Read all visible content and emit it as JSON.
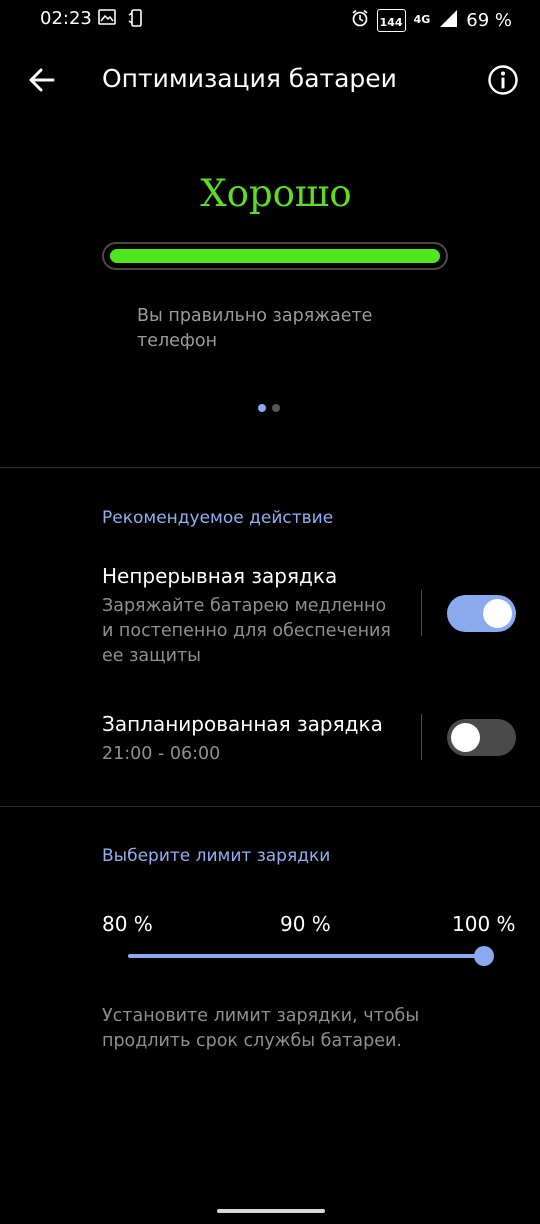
{
  "status_bar": {
    "time": "02:23",
    "refresh_rate": "144",
    "network": "4G",
    "battery": "69 %"
  },
  "app_bar": {
    "title": "Оптимизация батареи"
  },
  "health": {
    "status": "Хорошо",
    "level_fraction": 1.0,
    "color": "#5edb2a",
    "description": "Вы правильно заряжаете телефон"
  },
  "pager": {
    "pages": 2,
    "current": 1
  },
  "recommended": {
    "header": "Рекомендуемое действие",
    "items": [
      {
        "title": "Непрерывная зарядка",
        "summary": "Заряжайте батарею медленно и постепенно для обеспечения ее защиты",
        "enabled": true
      },
      {
        "title": "Запланированная зарядка",
        "summary": "21:00 - 06:00",
        "enabled": false
      }
    ]
  },
  "charge_limit": {
    "header": "Выберите лимит зарядки",
    "options": [
      "80 %",
      "90 %",
      "100 %"
    ],
    "selected": "100 %",
    "slider_fraction": 1.0,
    "description": "Установите лимит зарядки, чтобы продлить срок службы батареи."
  },
  "colors": {
    "accent": "#8aa9ee",
    "good": "#4fe61b",
    "section_header": "#93aef0"
  },
  "icons": {
    "back": "arrow-back-icon",
    "info": "info-icon",
    "alarm": "alarm-icon",
    "signal": "signal-icon"
  }
}
